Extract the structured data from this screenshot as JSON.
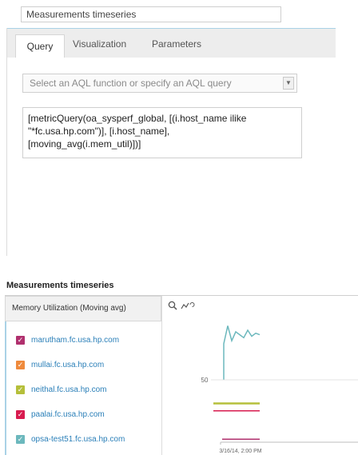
{
  "editor": {
    "title_value": "Measurements timeseries",
    "tabs": [
      {
        "label": "Query"
      },
      {
        "label": "Visualization"
      },
      {
        "label": "Parameters"
      }
    ],
    "aql_select_placeholder": "Select an AQL function or specify an AQL query",
    "query_text": "[metricQuery(oa_sysperf_global, [(i.host_name ilike\n\"*fc.usa.hp.com\")], [i.host_name],\n[moving_avg(i.mem_util)])]"
  },
  "widget": {
    "title": "Measurements timeseries",
    "series_header": "Memory Utilization (Moving avg)",
    "hosts": [
      {
        "label": "marutham.fc.usa.hp.com",
        "color": "#b0306e"
      },
      {
        "label": "mullai.fc.usa.hp.com",
        "color": "#ef8a3c"
      },
      {
        "label": "neithal.fc.usa.hp.com",
        "color": "#b5bf3a"
      },
      {
        "label": "paalai.fc.usa.hp.com",
        "color": "#d81b4f"
      },
      {
        "label": "opsa-test51.fc.usa.hp.com",
        "color": "#6cb8bd"
      }
    ],
    "tools": {
      "zoom_icon": "magnifier-icon",
      "reset_icon": "chart-reset-icon"
    }
  },
  "chart_data": {
    "type": "line",
    "title": "",
    "xlabel": "",
    "ylabel": "",
    "y_tick_labels": [
      "50"
    ],
    "x_tick_labels": [
      "3/16/14, 2:00 PM"
    ],
    "series": [
      {
        "name": "opsa-test51.fc.usa.hp.com",
        "color": "#6cb8bd",
        "values": [
          66,
          78,
          68,
          74,
          72,
          70,
          75,
          71,
          73,
          72
        ]
      },
      {
        "name": "neithal.fc.usa.hp.com",
        "color": "#b5bf3a",
        "values": [
          26,
          26,
          26,
          26,
          26,
          26,
          26,
          26,
          26,
          26
        ]
      },
      {
        "name": "paalai.fc.usa.hp.com",
        "color": "#d81b4f",
        "values": [
          21,
          21,
          21,
          21,
          21,
          21,
          21,
          21,
          21,
          21
        ]
      },
      {
        "name": "marutham.fc.usa.hp.com",
        "color": "#b0306e",
        "values": [
          2,
          2,
          2,
          2,
          2,
          2,
          2,
          2,
          2,
          2
        ]
      }
    ],
    "ylim": [
      0,
      90
    ]
  }
}
